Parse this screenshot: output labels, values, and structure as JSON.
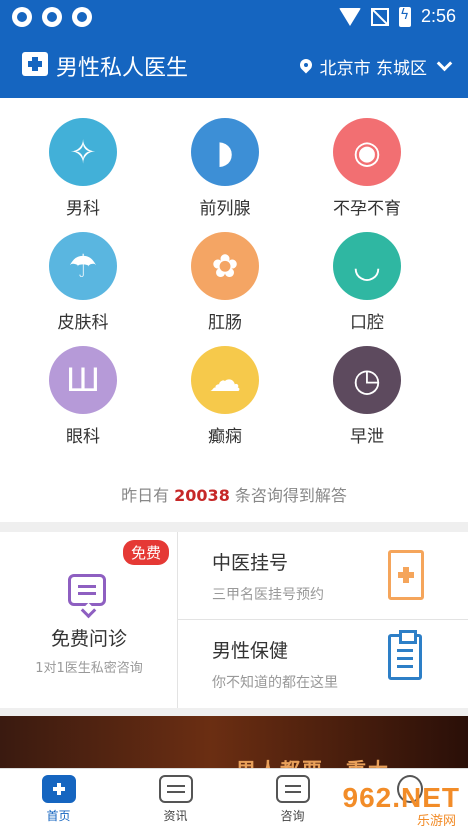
{
  "status": {
    "time": "2:56"
  },
  "appbar": {
    "title": "男性私人医生",
    "location": "北京市 东城区"
  },
  "categories": [
    {
      "label": "男科",
      "icon": "dragonfly-icon",
      "color": "#42b0d8",
      "glyph": "✧"
    },
    {
      "label": "前列腺",
      "icon": "whale-icon",
      "color": "#3d8fd6",
      "glyph": "◗"
    },
    {
      "label": "不孕不育",
      "icon": "sperm-icon",
      "color": "#f26f72",
      "glyph": "◉"
    },
    {
      "label": "皮肤科",
      "icon": "umbrella-icon",
      "color": "#5ab6e0",
      "glyph": "☂"
    },
    {
      "label": "肛肠",
      "icon": "flower-icon",
      "color": "#f4a564",
      "glyph": "✿"
    },
    {
      "label": "口腔",
      "icon": "tooth-icon",
      "color": "#2fb7a2",
      "glyph": "◡"
    },
    {
      "label": "眼科",
      "icon": "eye-chart-icon",
      "color": "#b69ad8",
      "glyph": "Ш"
    },
    {
      "label": "癫痫",
      "icon": "brain-icon",
      "color": "#f6c94b",
      "glyph": "☁"
    },
    {
      "label": "早泄",
      "icon": "clock-icon",
      "color": "#5d4a5e",
      "glyph": "◷"
    }
  ],
  "stat": {
    "prefix": "昨日有 ",
    "number": "20038",
    "suffix": " 条咨询得到解答"
  },
  "free_consult": {
    "badge": "免费",
    "title": "免费问诊",
    "subtitle": "1对1医生私密咨询"
  },
  "services": [
    {
      "title": "中医挂号",
      "subtitle": "三甲名医挂号预约"
    },
    {
      "title": "男性保健",
      "subtitle": "你不知道的都在这里"
    }
  ],
  "banner": {
    "text": "男人都要…重大…"
  },
  "nav": [
    {
      "label": "首页"
    },
    {
      "label": "资讯"
    },
    {
      "label": "咨询"
    },
    {
      "label": ""
    }
  ],
  "watermark": {
    "main": "962.NET",
    "sub": "乐游网"
  }
}
